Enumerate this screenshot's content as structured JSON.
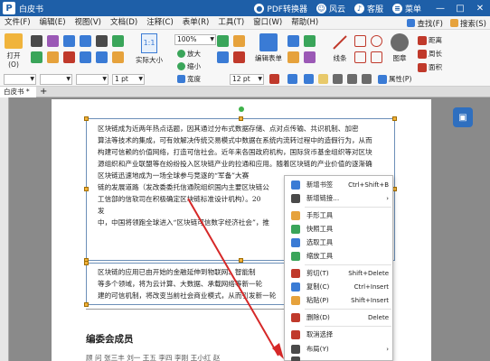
{
  "app": {
    "title": "白皮书",
    "logo": "P"
  },
  "titlebar_right": {
    "pdf_converter": "PDF转换器",
    "user": "风云",
    "service": "客服",
    "menu": "菜单"
  },
  "window_controls": {
    "minimize": "—",
    "maximize": "□",
    "close": "✕"
  },
  "menubar": {
    "items": [
      "文件(F)",
      "编辑(E)",
      "视图(V)",
      "文档(D)",
      "注释(C)",
      "表单(R)",
      "工具(T)",
      "窗口(W)",
      "帮助(H)"
    ],
    "find": "查找(F)",
    "search": "搜索(S)"
  },
  "toolbar": {
    "open_label": "打开(O)",
    "actual_size_label": "实际大小",
    "zoom_value": "100%",
    "zoom_in": "放大",
    "zoom_out": "缩小",
    "width_label": "宽度",
    "edit_form_label": "编辑表单",
    "line_label": "线条",
    "image_label": "图章",
    "distance": "距离",
    "perimeter": "周长",
    "area": "面积",
    "stroke_width": "1 pt",
    "font_size": "12 pt",
    "attributes": "属性(P)"
  },
  "tab": {
    "name": "白皮书 *",
    "add": "+"
  },
  "document": {
    "para1": [
      "区块链成为近两年热点话题，因其通过分布式数据存储、点对点传输、共识机制、加密",
      "算法等技术的集成，可有效解决传统交易模式中数据在系统内流转过程中的造假行为，从而",
      "构建可信赖的价值网络，打造可信社会。近年来各国政府机构，国际货币基金组织等对区块",
      "源组织和产业联盟等在纷纷投入区块链产业的拉通和应用。随着区块链的产业价值的逐渐确",
      "区块链迅速地成为一场全球参与竞逐的“军备”大赛",
      "链的发展道路（发改委委托信通院组织国内主要区块链公",
      "工信部的信软司在积极确定区块链标准设计机构）。20",
      "发",
      "中，中国将领跑全球进入“区块链可信数字经济社会”，推"
    ],
    "para2": [
      "区块链的应用已由开始的金融延伸到物联网、智能制",
      "等多个领域，将为云计算、大数据、承载网络等新一轮",
      "建的可信机制，将改变当前社会商业模式，从而引发新一轮"
    ],
    "heading": "编委会成员",
    "blurred_line": "顾  问  张三丰  刘一  王五  李四  李刚  王小红  赵"
  },
  "context_menu": {
    "items": [
      {
        "label": "新增书签",
        "shortcut": "Ctrl+Shift+B",
        "icon": "bookmark-icon",
        "color": "#3a7bd5"
      },
      {
        "label": "新增链接...",
        "shortcut": "›",
        "icon": "link-icon",
        "color": "#4a4a4a"
      },
      {
        "label": "手形工具",
        "shortcut": "",
        "icon": "hand-icon",
        "color": "#e6a23c"
      },
      {
        "label": "快照工具",
        "shortcut": "",
        "icon": "camera-icon",
        "color": "#3aa55a"
      },
      {
        "label": "选取工具",
        "shortcut": "",
        "icon": "select-icon",
        "color": "#3a7bd5"
      },
      {
        "label": "缩放工具",
        "shortcut": "",
        "icon": "zoom-icon",
        "color": "#3aa55a"
      },
      {
        "label": "剪切(T)",
        "shortcut": "Shift+Delete",
        "icon": "scissors-icon",
        "color": "#c0392b"
      },
      {
        "label": "复制(C)",
        "shortcut": "Ctrl+Insert",
        "icon": "copy-icon",
        "color": "#3a7bd5"
      },
      {
        "label": "粘贴(P)",
        "shortcut": "Shift+Insert",
        "icon": "paste-icon",
        "color": "#e6a23c"
      },
      {
        "label": "删除(D)",
        "shortcut": "Delete",
        "icon": "delete-icon",
        "color": "#c0392b"
      },
      {
        "label": "取消选择",
        "shortcut": "",
        "icon": "deselect-icon",
        "color": "#c0392b"
      },
      {
        "label": "布局(Y)",
        "shortcut": "›",
        "icon": "layout-icon",
        "color": "#4a4a4a"
      },
      {
        "label": "",
        "shortcut": "",
        "icon": "more-icon",
        "color": "#4a4a4a"
      }
    ]
  },
  "colors": {
    "accent": "#1e5fa8",
    "selection_handle": "#f1b13b",
    "arrow": "#d62828"
  }
}
